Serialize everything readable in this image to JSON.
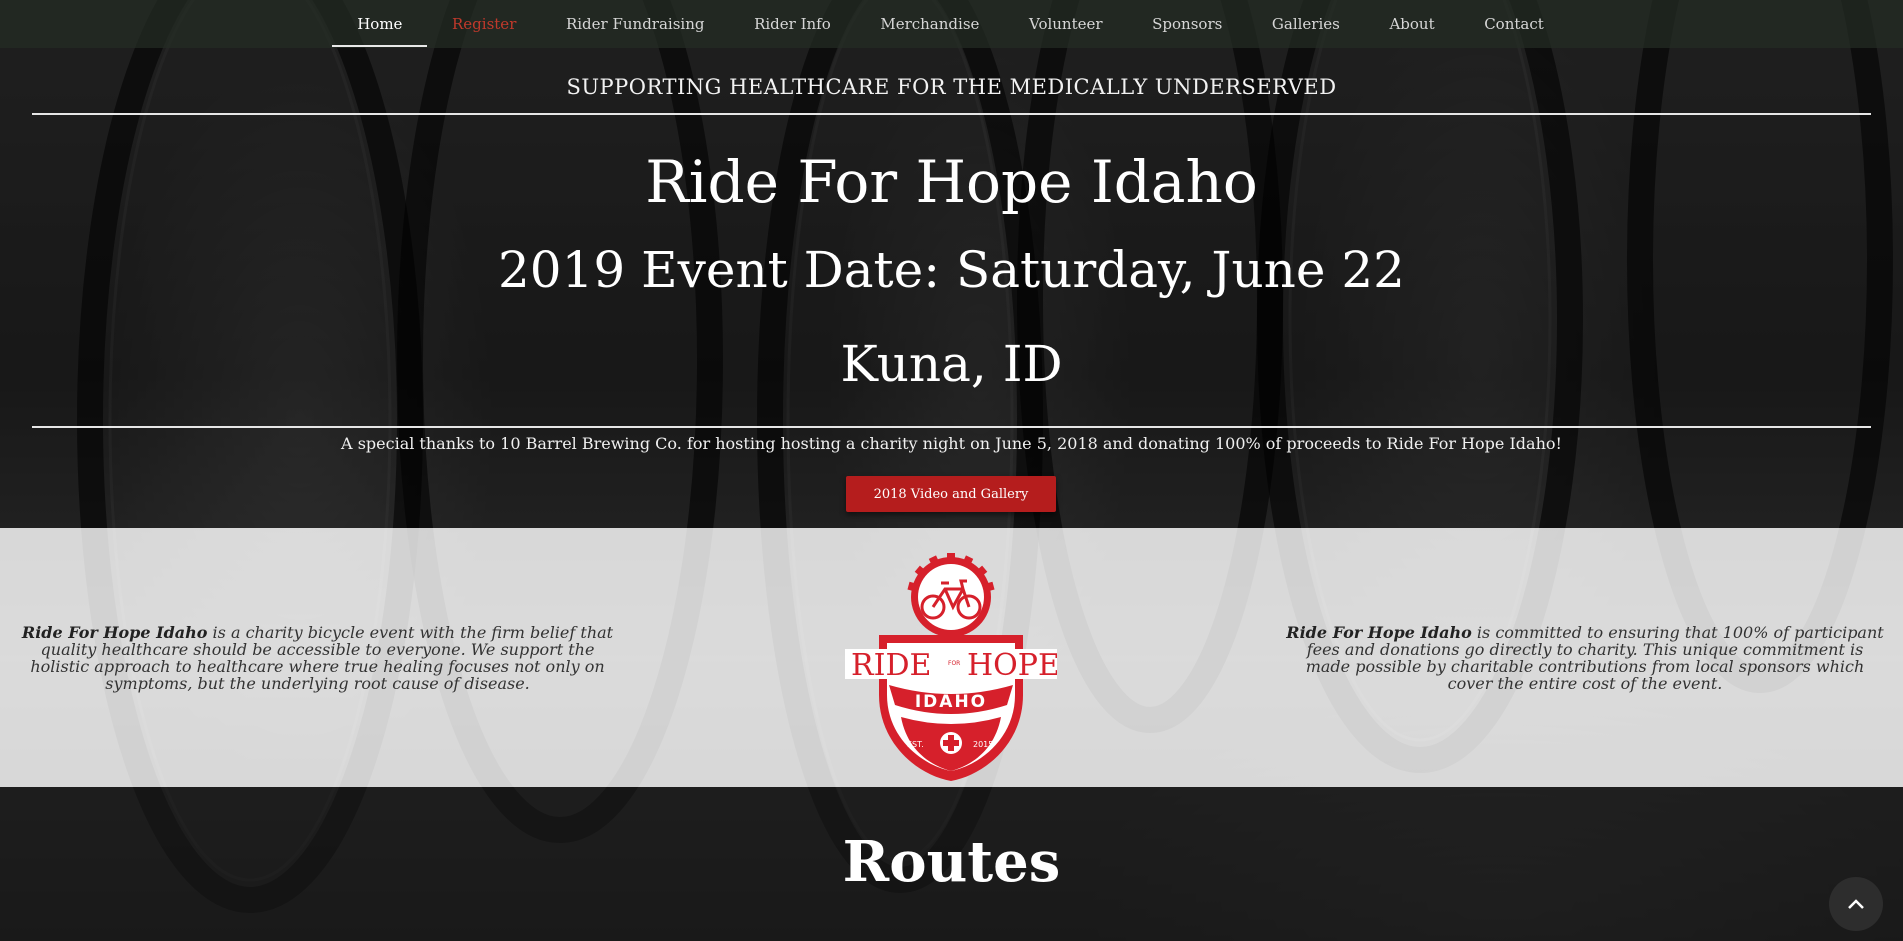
{
  "nav": {
    "items": [
      {
        "label": "Home"
      },
      {
        "label": "Register"
      },
      {
        "label": "Rider Fundraising"
      },
      {
        "label": "Rider Info"
      },
      {
        "label": "Merchandise"
      },
      {
        "label": "Volunteer"
      },
      {
        "label": "Sponsors"
      },
      {
        "label": "Galleries"
      },
      {
        "label": "About"
      },
      {
        "label": "Contact"
      }
    ]
  },
  "hero": {
    "tagline": "SUPPORTING HEALTHCARE FOR THE MEDICALLY UNDERSERVED",
    "title": "Ride For Hope Idaho",
    "date": "2019 Event Date: Saturday, June 22",
    "location": "Kuna, ID",
    "thanks": "A special thanks to 10 Barrel Brewing Co. for hosting hosting a charity night on June 5, 2018 and donating 100% of proceeds to Ride For Hope Idaho!",
    "button_label": "2018 Video and Gallery"
  },
  "band": {
    "left_bold": "Ride For Hope Idaho",
    "left_text": " is a charity bicycle event with the firm belief that quality healthcare should be accessible to everyone. We support the holistic approach to healthcare where true healing focuses not only on symptoms, but the underlying root cause of disease.",
    "right_bold": "Ride For Hope Idaho",
    "right_text": " is committed to ensuring that 100% of participant fees and donations go directly to charity. This unique commitment is made possible by charitable contributions from local sponsors which cover the entire cost of the event.",
    "logo": {
      "ride": "RIDE",
      "for": "FOR",
      "hope": "HOPE",
      "idaho": "IDAHO",
      "est": "EST.",
      "year": "2015"
    }
  },
  "routes": {
    "title": "Routes"
  },
  "colors": {
    "accent_red": "#d6202b",
    "button_red": "#b51d1d"
  },
  "icons": {
    "scroll_top": "chevron-up-icon",
    "logo_bike": "bicycle-icon",
    "logo_cross": "medical-cross-icon"
  }
}
